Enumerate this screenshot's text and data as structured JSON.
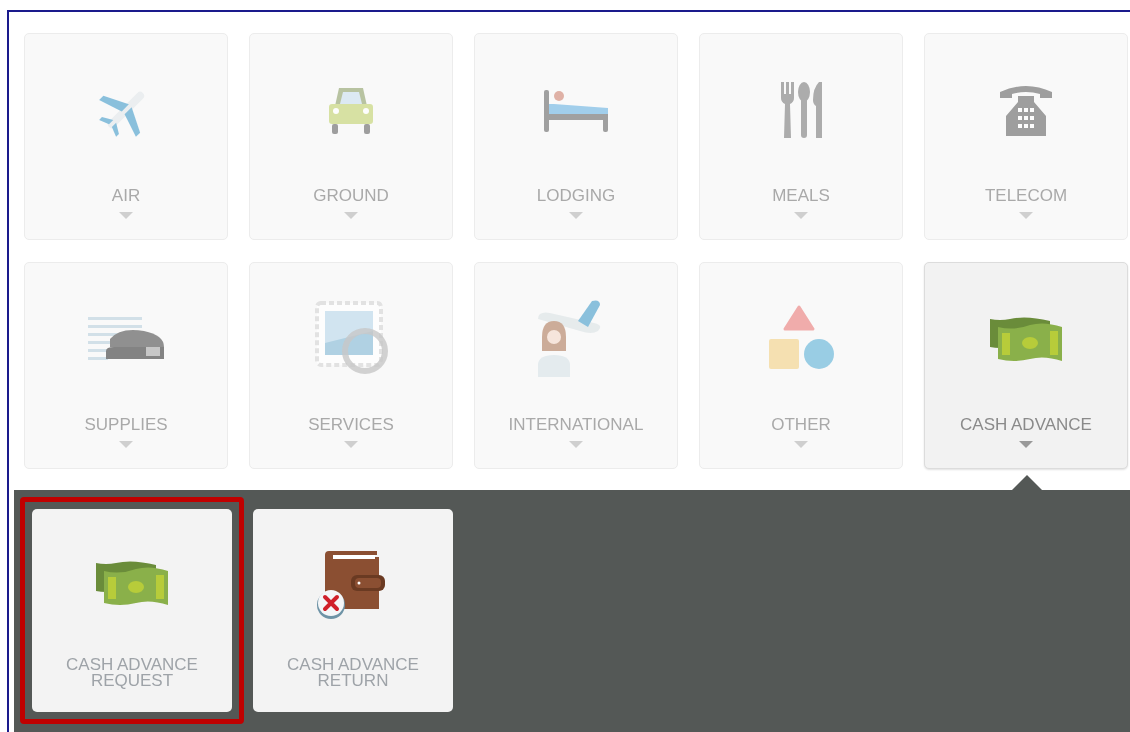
{
  "categories": [
    {
      "label": "AIR",
      "kind": "plane",
      "selected": false
    },
    {
      "label": "GROUND",
      "kind": "car",
      "selected": false
    },
    {
      "label": "LODGING",
      "kind": "bed",
      "selected": false
    },
    {
      "label": "MEALS",
      "kind": "cutlery",
      "selected": false
    },
    {
      "label": "TELECOM",
      "kind": "phone",
      "selected": false
    },
    {
      "label": "SUPPLIES",
      "kind": "stapler",
      "selected": false
    },
    {
      "label": "SERVICES",
      "kind": "stamp",
      "selected": false
    },
    {
      "label": "INTERNATIONAL",
      "kind": "traveler",
      "selected": false
    },
    {
      "label": "OTHER",
      "kind": "shapes",
      "selected": false
    },
    {
      "label": "CASH ADVANCE",
      "kind": "cash",
      "selected": true
    }
  ],
  "subitems": [
    {
      "label": "CASH ADVANCE REQUEST",
      "kind": "cash",
      "highlighted": true
    },
    {
      "label": "CASH ADVANCE RETURN",
      "kind": "wallet",
      "highlighted": false
    }
  ]
}
